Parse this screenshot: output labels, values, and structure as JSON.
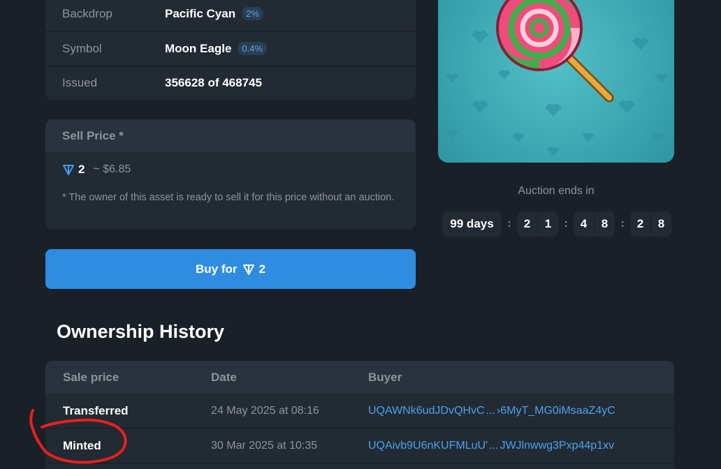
{
  "attributes": [
    {
      "label": "Backdrop",
      "value": "Pacific Cyan",
      "badge": "2%"
    },
    {
      "label": "Symbol",
      "value": "Moon Eagle",
      "badge": "0.4%"
    },
    {
      "label": "Issued",
      "value": "356628 of 468745",
      "badge": ""
    }
  ],
  "sell": {
    "header": "Sell Price *",
    "amount": "2",
    "usd": "~ $6.85",
    "note": "* The owner of this asset is ready to sell it for this price without an auction."
  },
  "buy_button": {
    "label": "Buy for",
    "amount": "2"
  },
  "auction": {
    "label": "Auction ends in",
    "days": "99 days",
    "hours": [
      "2",
      "1"
    ],
    "minutes": [
      "4",
      "8"
    ],
    "seconds": [
      "2",
      "8"
    ],
    "separator": ":"
  },
  "history": {
    "title": "Ownership History",
    "columns": [
      "Sale price",
      "Date",
      "Buyer"
    ],
    "rows": [
      {
        "sale": "Transferred",
        "date": "24 May 2025 at 08:16",
        "buyer_start": "UQAWNk6udJDvQHvC",
        "buyer_end": "›6MyT_MG0iMsaaZ4yC"
      },
      {
        "sale": "Minted",
        "date": "30 Mar 2025 at 10:35",
        "buyer_start": "UQAivb9U6nKUFMLuU'",
        "buyer_end": "JWJlnwwg3Pxp44p1xv"
      }
    ],
    "ellipsis": "..."
  },
  "colors": {
    "background": "#1a2028",
    "card": "#222a34",
    "accent": "#2e8de0",
    "link": "#4ba3ea",
    "nft_backdrop": "#3da9b3",
    "annotation": "#e8201c"
  },
  "icons": {
    "ton": "ton-currency-icon"
  }
}
